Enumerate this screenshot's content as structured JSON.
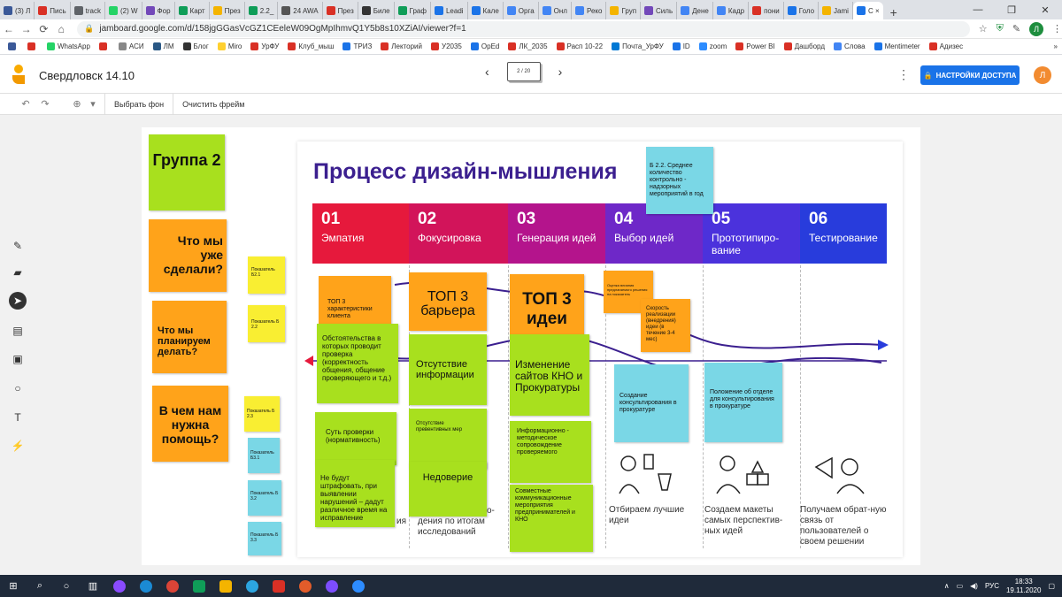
{
  "browser": {
    "tabs": [
      {
        "label": "(3) Л",
        "color": "#3b5998"
      },
      {
        "label": "Пись",
        "color": "#d93025"
      },
      {
        "label": "track",
        "color": "#5f6368"
      },
      {
        "label": "(2) W",
        "color": "#25d366"
      },
      {
        "label": "Фор",
        "color": "#7248b9"
      },
      {
        "label": "Карт",
        "color": "#0f9d58"
      },
      {
        "label": "През",
        "color": "#f4b400"
      },
      {
        "label": "2.2_",
        "color": "#0f9d58"
      },
      {
        "label": "24 AWA",
        "color": "#555555"
      },
      {
        "label": "През",
        "color": "#d93025"
      },
      {
        "label": "Биле",
        "color": "#333333"
      },
      {
        "label": "Граф",
        "color": "#0f9d58"
      },
      {
        "label": "Leadi",
        "color": "#1a73e8"
      },
      {
        "label": "Кале",
        "color": "#1a73e8"
      },
      {
        "label": "Орга",
        "color": "#4285f4"
      },
      {
        "label": "Онл",
        "color": "#4285f4"
      },
      {
        "label": "Реко",
        "color": "#4285f4"
      },
      {
        "label": "Груп",
        "color": "#f4b400"
      },
      {
        "label": "Силь",
        "color": "#7248b9"
      },
      {
        "label": "Дене",
        "color": "#4285f4"
      },
      {
        "label": "Кадр",
        "color": "#4285f4"
      },
      {
        "label": "пони",
        "color": "#d93025"
      },
      {
        "label": "Голо",
        "color": "#1a73e8"
      },
      {
        "label": "Jami",
        "color": "#f4b400"
      },
      {
        "label": "С ×",
        "color": "#1a73e8"
      }
    ],
    "new_tab": "+",
    "window_controls": [
      "—",
      "❐",
      "✕"
    ],
    "url": "jamboard.google.com/d/158jgGGasVcGZ1CEeleW09OgMpIhmvQ1Y5b8s10XZiAI/viewer?f=1",
    "profile_initial": "Л",
    "bookmarks": [
      {
        "label": "",
        "color": "#3b5998"
      },
      {
        "label": "",
        "color": "#d93025"
      },
      {
        "label": "WhatsApp",
        "color": "#25d366"
      },
      {
        "label": "",
        "color": "#d93025"
      },
      {
        "label": "АСИ",
        "color": "#888888"
      },
      {
        "label": "ЛМ",
        "color": "#2a5885"
      },
      {
        "label": "Блог",
        "color": "#333333"
      },
      {
        "label": "Miro",
        "color": "#ffd02f"
      },
      {
        "label": "УрФУ",
        "color": "#d93025"
      },
      {
        "label": "Клуб_мыш",
        "color": "#d93025"
      },
      {
        "label": "ТРИЗ",
        "color": "#1a73e8"
      },
      {
        "label": "Лекторий",
        "color": "#d93025"
      },
      {
        "label": "У2035",
        "color": "#d93025"
      },
      {
        "label": "OpEd",
        "color": "#1a73e8"
      },
      {
        "label": "ЛК_2035",
        "color": "#d93025"
      },
      {
        "label": "Расп 10-22",
        "color": "#d93025"
      },
      {
        "label": "Почта_УрФУ",
        "color": "#0078d4"
      },
      {
        "label": "ID",
        "color": "#1a73e8"
      },
      {
        "label": "zoom",
        "color": "#2d8cff"
      },
      {
        "label": "Power BI",
        "color": "#d93025"
      },
      {
        "label": "Дашборд",
        "color": "#d93025"
      },
      {
        "label": "Слова",
        "color": "#4285f4"
      },
      {
        "label": "Mentimeter",
        "color": "#1a73e8"
      },
      {
        "label": "Адизес",
        "color": "#d93025"
      }
    ],
    "bookmarks_more": "»"
  },
  "jamboard": {
    "title": "Свердловск 14.10",
    "frame_counter": "2 / 20",
    "share_label": "НАСТРОЙКИ ДОСТУПА",
    "user_initial": "Л",
    "toolbar": {
      "zoom_icon": "⊕",
      "zoom_caret": "▾",
      "set_background": "Выбрать фон",
      "clear_frame": "Очистить фрейм"
    }
  },
  "slide": {
    "title": "Процесс дизайн-мышления",
    "stages": [
      {
        "num": "01",
        "name": "Эмпатия",
        "color": "#e6193c"
      },
      {
        "num": "02",
        "name": "Фокусировка",
        "color": "#d2145a"
      },
      {
        "num": "03",
        "name": "Генерация идей",
        "color": "#b4148c"
      },
      {
        "num": "04",
        "name": "Выбор идей",
        "color": "#6e28c8"
      },
      {
        "num": "05",
        "name": "Прототипиро-вание",
        "color": "#4b32dc"
      },
      {
        "num": "06",
        "name": "Тестирование",
        "color": "#283cdc"
      }
    ],
    "bottom": [
      "ия",
      "о-",
      "дения по итогам исследований",
      "Отбираем лучшие идеи",
      "Создаем макеты самых перспектив-ных идей",
      "Получаем обрат-ную связь от пользователей о своем решении"
    ]
  },
  "stickies": {
    "group": "Группа 2",
    "q1": "Что мы уже сделали?",
    "q2": "Что мы планируем делать?",
    "q3": "В чем нам нужна помощь?",
    "y1": "Показатель Б2.1",
    "y2": "Показатель Б 2.2",
    "y3": "Показатель Б 2.3",
    "c1": "Показатель Б3.1",
    "c2": "Показатель Б 3.2",
    "c3": "Показатель Б 3.3",
    "top_cyan": "Б 2.2. Среднее количество контрольно - надзорных мероприятий в год",
    "o_top3_chars": "ТОП 3 характеристики клиента",
    "o_top3_barriers": "ТОП 3 барьера",
    "o_top3_ideas": "ТОП 3 идеи",
    "o_eval": "Оценка влияния предлагаемого решения на показатель",
    "o_speed": "Скорость реализации (внедрения) идеи (в течение 3-4 мес)",
    "g_circumstances": "Обстоятельства в которых проводит проверка (корректность общения, общение проверяющего и т.д.)",
    "g_no_info": "Отсутствие информации",
    "g_sites": "Изменение сайтов КНО и Прокуратуры",
    "g_essence": "Суть проверки (нормативность)",
    "g_no_preventive": "Отсутствие превентивных мер",
    "g_info_support": "Информационно - методическое сопровождение проверяемого",
    "g_no_fine": "Не будут штрафовать, при выявлении нарушений – дадут различное время на исправление",
    "g_distrust": "Недоверие",
    "g_joint": "Совместные коммуникационные мероприятия предпринимателей и КНО",
    "cy_consult": "Создание консультирования в прокуратуре",
    "cy_dept": "Положение об отделе для консультирования в прокуратуре"
  },
  "taskbar": {
    "time": "18:33",
    "date": "19.11.2020",
    "lang": "РУС"
  }
}
